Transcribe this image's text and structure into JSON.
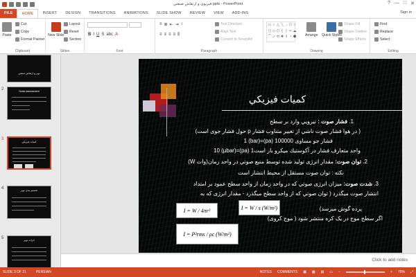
{
  "window": {
    "title": "فيزيوی و ارتقاش صنعتي.pptx - PowerPoint",
    "controls": [
      "?",
      "—",
      "□",
      "✕"
    ]
  },
  "tabs": [
    "FILE",
    "HOME",
    "INSERT",
    "DESIGN",
    "TRANSITIONS",
    "ANIMATIONS",
    "SLIDE SHOW",
    "REVIEW",
    "VIEW",
    "ADD-INS"
  ],
  "signin": "Sign in",
  "ribbon": {
    "clipboard": {
      "label": "Clipboard",
      "paste": "Paste",
      "cut": "Cut",
      "copy": "Copy",
      "format_painter": "Format Painter"
    },
    "slides": {
      "label": "Slides",
      "new_slide": "New Slide",
      "layout": "Layout",
      "reset": "Reset",
      "section": "Section"
    },
    "font": {
      "label": "Font"
    },
    "paragraph": {
      "label": "Paragraph",
      "text_direction": "Text Direction",
      "align_text": "Align Text",
      "convert": "Convert to SmartArt"
    },
    "drawing": {
      "label": "Drawing",
      "arrange": "Arrange",
      "quick_styles": "Quick Styles",
      "shape_fill": "Shape Fill",
      "shape_outline": "Shape Outline",
      "shape_effects": "Shape Effects"
    },
    "editing": {
      "label": "Editing",
      "find": "Find",
      "replace": "Replace",
      "select": "Select"
    }
  },
  "thumbnails": [
    {
      "num": "",
      "title": "نويز و ارتقاش صنعتي"
    },
    {
      "num": "2",
      "title": "Noise assessment"
    },
    {
      "num": "3",
      "title": "كميات فيزيكي"
    },
    {
      "num": "4",
      "title": "تقسيم بندی نويز"
    },
    {
      "num": "5",
      "title": "اثرات نويز"
    }
  ],
  "slide": {
    "title": "كميات فيزيكي",
    "lines": [
      {
        "t": "فشار صوت :",
        "rest": " نيرويي وارد بر سطح",
        "n": "1."
      },
      {
        "t": "",
        "rest": "( در هوا فشار صوت ناشي از تغيير متناوب فشار p حول فشار جوی است)"
      },
      {
        "t": "",
        "rest": "فشار جو مساوی 100000 (pa)=1 (bar)"
      },
      {
        "t": "",
        "rest": "واحد متعارف فشار در آكوستيك ميكرو بار است1 (pa)=10 (µbar)"
      },
      {
        "t": "توان صوت:",
        "rest": " مقدار انرژی توليد شده توسط منبع صوتي در واحد زمان(وات W)",
        "n": "2."
      },
      {
        "t": "",
        "rest": "نكته : توان صوت مستقل از محيط انتشار است"
      },
      {
        "t": "شدت صوت:",
        "rest": " ميزان انرژی صوتي كه در واحد زمان از واحد سطح عمود بر امتداد",
        "n": "3."
      },
      {
        "t": "",
        "rest": "انتشار صوت ميگذرد ( توان صوتي كه از واحد سطح ميگذرد - مقدار انرژی كه به"
      },
      {
        "t": "",
        "rest": "پرده گوش ميرسد)"
      },
      {
        "t": "",
        "rest": "اگر سطح موج در يک كره منتشر شود ( موج كروی)"
      }
    ],
    "formulas": [
      "I = W / 4πr²",
      "I = W / s   (W/m²)",
      "I = P²rms / ρc   (W/m²)"
    ]
  },
  "notes": "Click to add notes",
  "status": {
    "slide": "SLIDE 3 OF 21",
    "lang": "PERSIAN",
    "notes": "NOTES",
    "comments": "COMMENTS",
    "zoom": "70%"
  }
}
